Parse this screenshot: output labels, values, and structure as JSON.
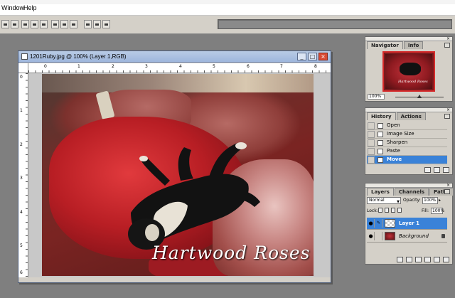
{
  "menubar": {
    "items": [
      "Window",
      "Help"
    ]
  },
  "document": {
    "title": "1201Ruby.jpg @ 100% (Layer 1,RGB)",
    "buttons": {
      "minimize": "_",
      "maximize": "□",
      "close": "×"
    },
    "ruler_top": [
      "0",
      "1",
      "2",
      "3",
      "4",
      "5",
      "6",
      "7",
      "8"
    ],
    "ruler_left": [
      "0",
      "1",
      "2",
      "3",
      "4",
      "5",
      "6"
    ],
    "watermark": "Hartwood Roses"
  },
  "navigator": {
    "tabs": [
      "Navigator",
      "Info"
    ],
    "zoom": "100%",
    "thumb_text": "Hartwood Roses"
  },
  "history": {
    "tabs": [
      "History",
      "Actions"
    ],
    "items": [
      {
        "label": "Open",
        "active": false
      },
      {
        "label": "Image Size",
        "active": false
      },
      {
        "label": "Sharpen",
        "active": false
      },
      {
        "label": "Paste",
        "active": false
      },
      {
        "label": "Move",
        "active": true
      }
    ]
  },
  "layers": {
    "tabs": [
      "Layers",
      "Channels",
      "Paths"
    ],
    "blend_mode": "Normal",
    "opacity_label": "Opacity:",
    "opacity": "100%",
    "lock_label": "Lock:",
    "fill_label": "Fill:",
    "fill": "100%",
    "items": [
      {
        "name": "Layer 1",
        "active": true
      },
      {
        "name": "Background",
        "active": false
      }
    ]
  },
  "colors": {
    "selection": "#3a82d8",
    "panel_bg": "#d4d0c8",
    "workspace": "#7f7f7f"
  }
}
